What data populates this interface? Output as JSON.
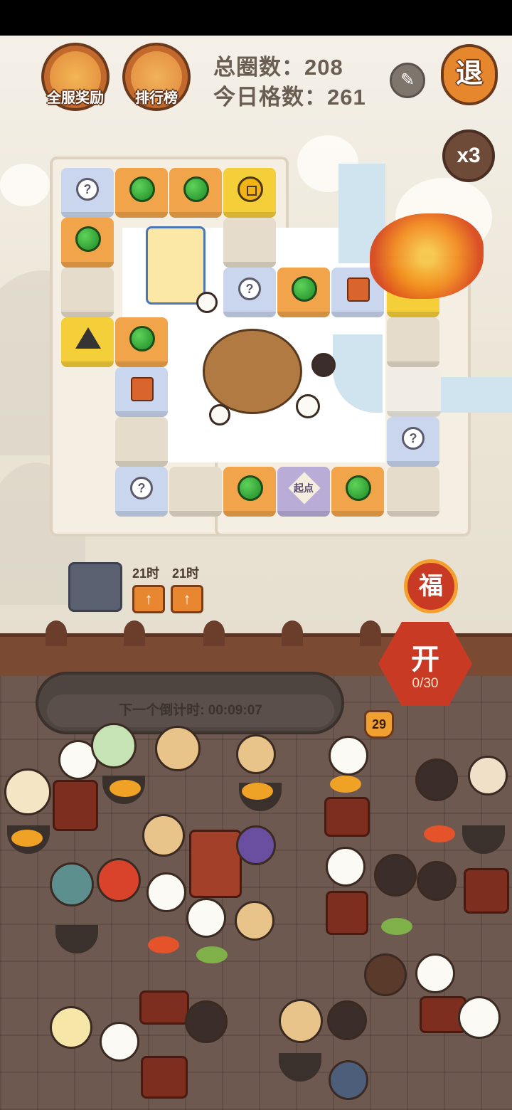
{
  "top_bar": {
    "server_reward_label": "全服奖励",
    "leaderboard_label": "排行榜",
    "total_laps_label": "总圈数：",
    "total_laps_value": "208",
    "today_tiles_label": "今日格数：",
    "today_tiles_value": "261",
    "exit_label": "退",
    "multiplier_label": "x3"
  },
  "board": {
    "start_label": "起点",
    "question_mark": "?"
  },
  "boosts": [
    {
      "label": "21时"
    },
    {
      "label": "21时"
    }
  ],
  "fortune_label": "福",
  "kitchen": {
    "open_label": "开",
    "open_progress": "0/30",
    "countdown_label": "下一个倒计时:",
    "countdown_value": "00:09:07",
    "level_badge": "29"
  }
}
